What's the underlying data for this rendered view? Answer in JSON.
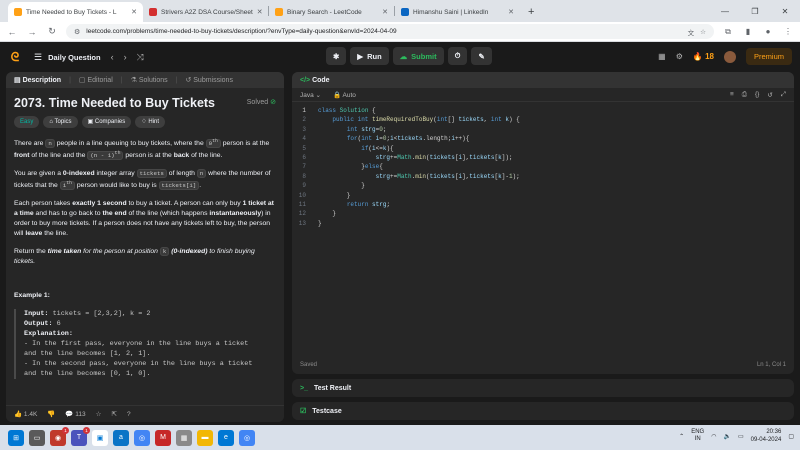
{
  "browser": {
    "tabs": [
      {
        "title": "Time Needed to Buy Tickets - L",
        "icon": "leetcode-icon",
        "active": true,
        "color": "#ffa116"
      },
      {
        "title": "Strivers A2Z DSA Course/Sheet",
        "icon": "takeuforward-icon",
        "active": false,
        "color": "#d32f2f"
      },
      {
        "title": "Binary Search - LeetCode",
        "icon": "leetcode-icon",
        "active": false,
        "color": "#ffa116"
      },
      {
        "title": "Himanshu Saini | LinkedIn",
        "icon": "linkedin-icon",
        "active": false,
        "color": "#0a66c2"
      }
    ],
    "url": "leetcode.com/problems/time-needed-to-buy-tickets/description/?envType=daily-question&envId=2024-04-09"
  },
  "nav": {
    "daily_label": "Daily Question",
    "run_label": "Run",
    "submit_label": "Submit",
    "streak": "18",
    "premium_label": "Premium"
  },
  "left": {
    "tabs": [
      "Description",
      "Editorial",
      "Solutions",
      "Submissions"
    ],
    "title": "2073. Time Needed to Buy Tickets",
    "solved_label": "Solved",
    "chips": [
      "Easy",
      "Topics",
      "Companies",
      "Hint"
    ],
    "p1": {
      "a": "There are ",
      "b": "n",
      "c": " people in a line queuing to buy tickets, where the ",
      "d": "0",
      "e": "th",
      "f": " person is at the ",
      "g": "front",
      "h": " of the line and the ",
      "i": "(n - 1)",
      "j": "th",
      "k": " person is at the ",
      "l": "back",
      "m": " of the line."
    },
    "p2": {
      "a": "You are given a ",
      "b": "0-indexed",
      "c": " integer array ",
      "d": "tickets",
      "e": " of length ",
      "f": "n",
      "g": " where the number of tickets that the ",
      "h": "i",
      "i": "th",
      "j": " person would like to buy is ",
      "k": "tickets[i]",
      "l": "."
    },
    "p3": {
      "a": "Each person takes ",
      "b": "exactly 1 second",
      "c": " to buy a ticket. A person can only buy ",
      "d": "1 ticket at a time",
      "e": " and has to go back to ",
      "f": "the end",
      "g": " of the line (which happens ",
      "h": "instantaneously",
      "i": ") in order to buy more tickets. If a person does not have any tickets left to buy, the person will ",
      "j": "leave",
      "k": " the line."
    },
    "p4": {
      "a": "Return the ",
      "b": "time taken",
      "c": " for the person at position ",
      "d": "k",
      "e": " ",
      "f": "(0-indexed)",
      "g": " to finish buying tickets."
    },
    "example_title": "Example 1:",
    "example": {
      "input_label": "Input:",
      "input": " tickets = [2,3,2], k = 2",
      "output_label": "Output:",
      "output": " 6",
      "expl_label": "Explanation:",
      "e1": "- In the first pass, everyone in the line buys a ticket",
      "e2": "and the line becomes [1, 2, 1].",
      "e3": "- In the second pass, everyone in the line buys a ticket",
      "e4": "and the line becomes [0, 1, 0]."
    },
    "likes": "1.4K",
    "comments": "113"
  },
  "editor": {
    "header": "Code",
    "language": "Java",
    "mode": "Auto",
    "saved": "Saved",
    "cursor": "Ln 1, Col 1",
    "lines": [
      "class Solution {",
      "    public int timeRequiredToBuy(int[] tickets, int k) {",
      "        int strg=0;",
      "        for(int i=0;i<tickets.length;i++){",
      "            if(i<=k){",
      "                strg+=Math.min(tickets[i],tickets[k]);",
      "            }else{",
      "                strg+=Math.min(tickets[i],tickets[k]-1);",
      "            }",
      "        }",
      "        return strg;",
      "    }",
      "}"
    ]
  },
  "bottom": {
    "test_result": "Test Result",
    "testcase": "Testcase"
  },
  "taskbar": {
    "lang1": "ENG",
    "lang2": "IN",
    "time": "20:36",
    "date": "09-04-2024"
  }
}
